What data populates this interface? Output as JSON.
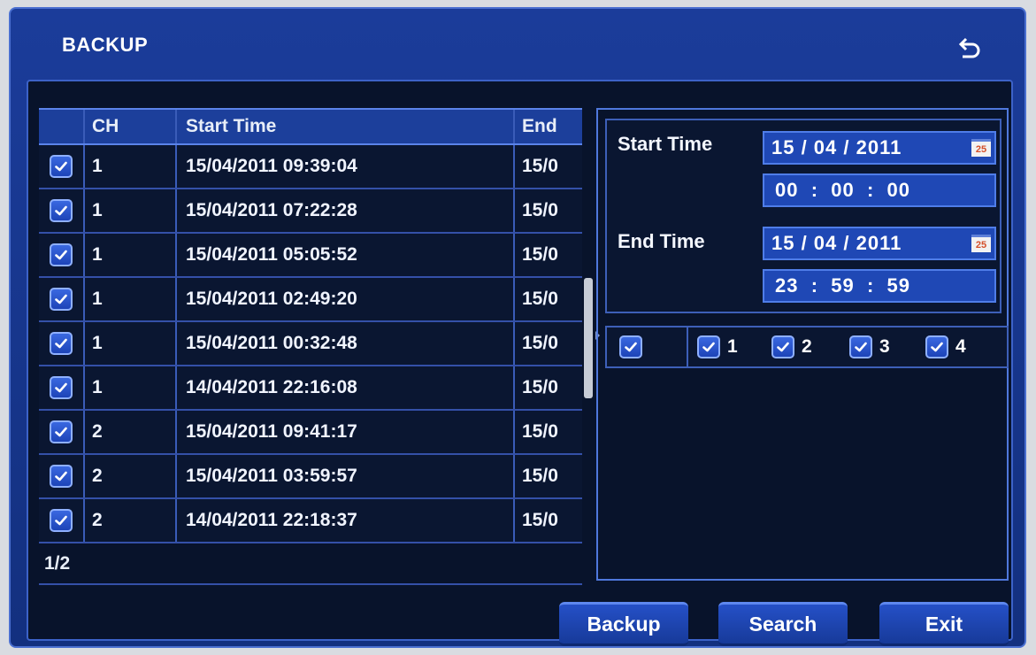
{
  "window": {
    "title": "BACKUP",
    "back_icon": "return-arrow-icon"
  },
  "table": {
    "columns": [
      "",
      "CH",
      "Start Time",
      "End"
    ],
    "rows": [
      {
        "checked": true,
        "ch": "1",
        "start": "15/04/2011 09:39:04",
        "end": "15/0"
      },
      {
        "checked": true,
        "ch": "1",
        "start": "15/04/2011 07:22:28",
        "end": "15/0"
      },
      {
        "checked": true,
        "ch": "1",
        "start": "15/04/2011 05:05:52",
        "end": "15/0"
      },
      {
        "checked": true,
        "ch": "1",
        "start": "15/04/2011 02:49:20",
        "end": "15/0"
      },
      {
        "checked": true,
        "ch": "1",
        "start": "15/04/2011 00:32:48",
        "end": "15/0"
      },
      {
        "checked": true,
        "ch": "1",
        "start": "14/04/2011 22:16:08",
        "end": "15/0"
      },
      {
        "checked": true,
        "ch": "2",
        "start": "15/04/2011 09:41:17",
        "end": "15/0"
      },
      {
        "checked": true,
        "ch": "2",
        "start": "15/04/2011 03:59:57",
        "end": "15/0"
      },
      {
        "checked": true,
        "ch": "2",
        "start": "14/04/2011 22:18:37",
        "end": "15/0"
      }
    ],
    "page": "1/2"
  },
  "filter": {
    "start_label": "Start Time",
    "start_date": "15 / 04 / 2011",
    "start_time": "00  :  00  :  00",
    "end_label": "End Time",
    "end_date": "15 / 04 / 2011",
    "end_time": "23  :  59  :  59",
    "calendar_badge": "25",
    "channels": [
      {
        "label": "",
        "checked": true
      },
      {
        "label": "1",
        "checked": true
      },
      {
        "label": "2",
        "checked": true
      },
      {
        "label": "3",
        "checked": true
      },
      {
        "label": "4",
        "checked": true
      }
    ]
  },
  "buttons": {
    "backup": "Backup",
    "search": "Search",
    "exit": "Exit"
  },
  "colors": {
    "panel": "#1b3c9a",
    "dark": "#08132b",
    "accent": "#4f78dc",
    "field": "#1f48b5"
  }
}
